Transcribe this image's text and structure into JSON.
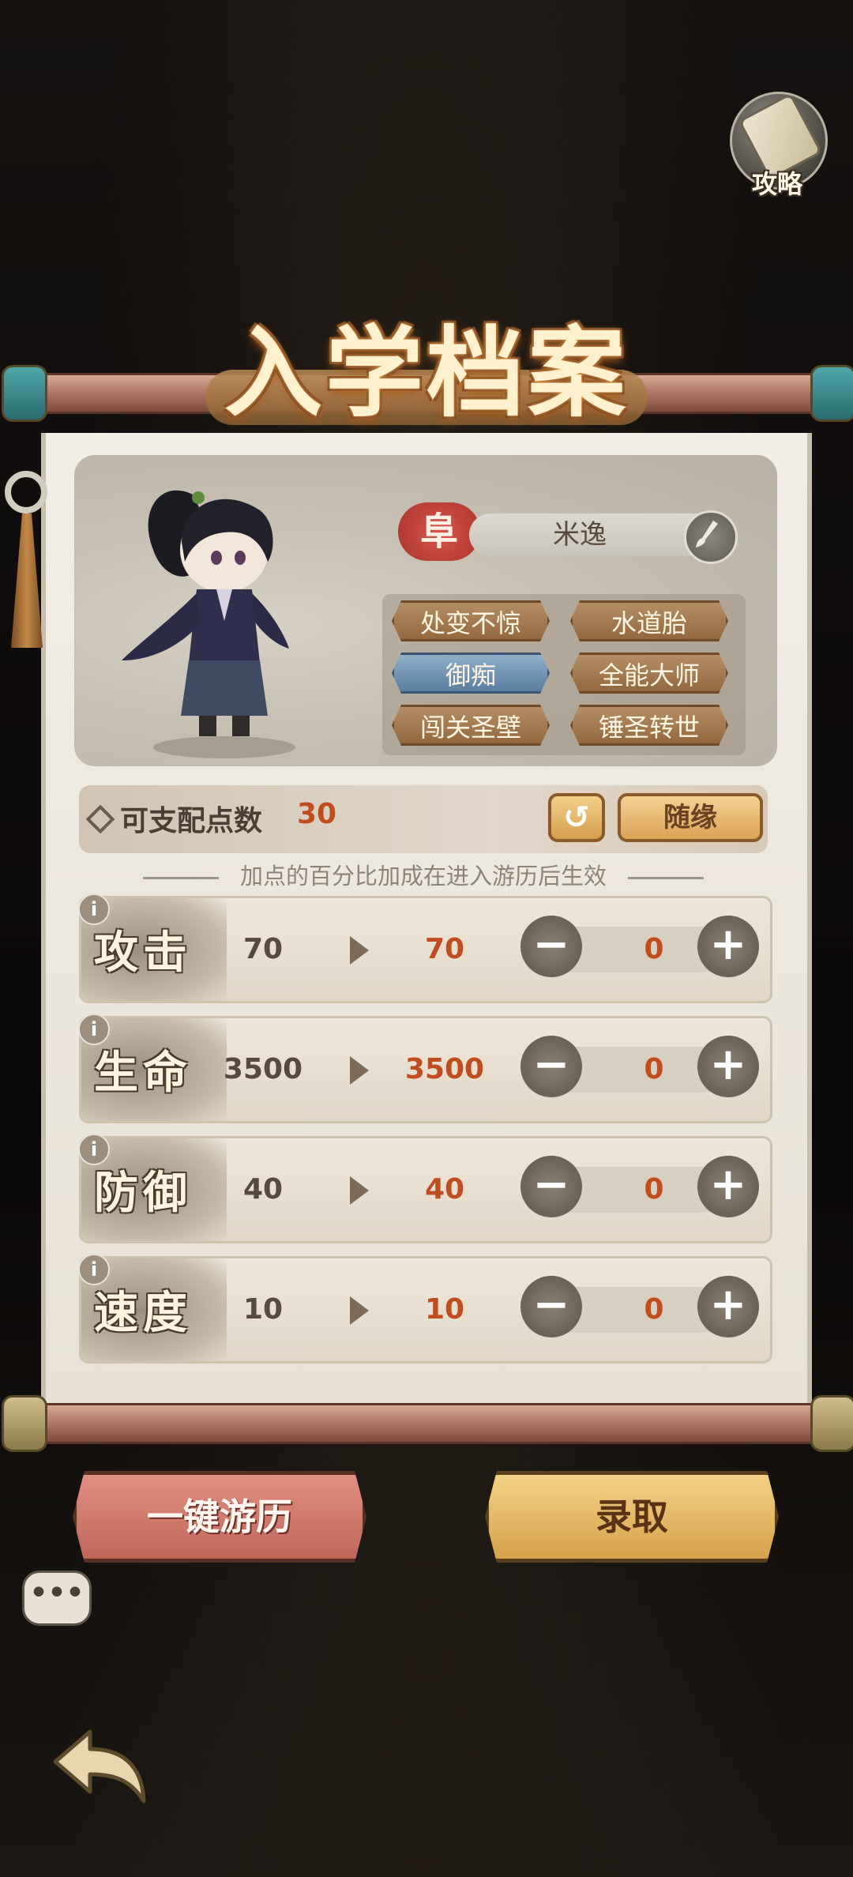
{
  "guide": {
    "label": "攻略",
    "icon": "scroll-icon"
  },
  "title": "入学档案",
  "profile": {
    "rank": "阜",
    "name": "米逸",
    "traits": [
      {
        "label": "处变不惊",
        "selected": false
      },
      {
        "label": "水道胎",
        "selected": false
      },
      {
        "label": "御痴",
        "selected": true
      },
      {
        "label": "全能大师",
        "selected": false
      },
      {
        "label": "闯关圣壁",
        "selected": false
      },
      {
        "label": "锤圣转世",
        "selected": false
      }
    ]
  },
  "points": {
    "label": "可支配点数",
    "value": "30",
    "reset_icon": "undo-icon",
    "reset_glyph": "↺",
    "random_label": "随缘"
  },
  "hint": "加点的百分比加成在进入游历后生效",
  "stats": [
    {
      "name": "攻击",
      "base": "70",
      "new": "70",
      "added": "0"
    },
    {
      "name": "生命",
      "base": "3500",
      "new": "3500",
      "added": "0"
    },
    {
      "name": "防御",
      "base": "40",
      "new": "40",
      "added": "0"
    },
    {
      "name": "速度",
      "base": "10",
      "new": "10",
      "added": "0"
    }
  ],
  "stepper": {
    "minus": "−",
    "plus": "+",
    "info": "i"
  },
  "actions": {
    "travel": "一键游历",
    "admit": "录取"
  },
  "chat_glyph": "•••",
  "colors": {
    "accent_red": "#c04d20",
    "selected_trait": "#6f93b5",
    "trait": "#a97e55",
    "travel_button": "#d07a6d",
    "admit_button": "#e6b967"
  }
}
